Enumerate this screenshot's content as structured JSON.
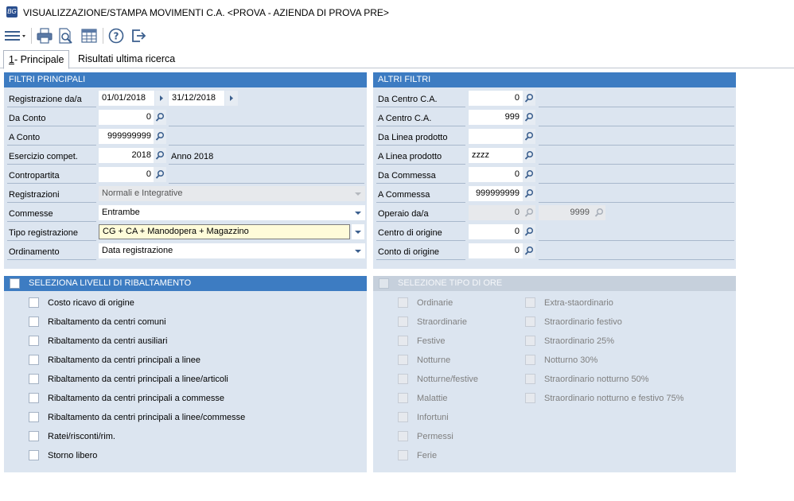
{
  "window": {
    "title": "VISUALIZZAZIONE/STAMPA MOVIMENTI C.A. <PROVA - AZIENDA DI PROVA PRE>",
    "icon": "app-logo-icon"
  },
  "toolbar": {
    "icons": [
      "menu-icon",
      "print-icon",
      "print-preview-icon",
      "grid-icon",
      "help-icon",
      "exit-icon"
    ]
  },
  "tabs": [
    {
      "underline": "1",
      "label": "- Principale"
    },
    {
      "label": "Risultati ultima ricerca"
    }
  ],
  "filtri_principali": {
    "title": "FILTRI PRINCIPALI",
    "registrazione": {
      "label": "Registrazione da/a",
      "from": "01/01/2018",
      "to": "31/12/2018"
    },
    "da_conto": {
      "label": "Da Conto",
      "value": "0"
    },
    "a_conto": {
      "label": "A Conto",
      "value": "999999999"
    },
    "esercizio": {
      "label": "Esercizio compet.",
      "value": "2018",
      "desc": "Anno 2018"
    },
    "contropartita": {
      "label": "Contropartita",
      "value": "0"
    },
    "registrazioni": {
      "label": "Registrazioni",
      "value": "Normali e Integrative"
    },
    "commesse": {
      "label": "Commesse",
      "value": "Entrambe"
    },
    "tipo_registrazione": {
      "label": "Tipo registrazione",
      "value": "CG + CA + Manodopera + Magazzino"
    },
    "ordinamento": {
      "label": "Ordinamento",
      "value": "Data registrazione"
    }
  },
  "altri_filtri": {
    "title": "ALTRI FILTRI",
    "da_centro": {
      "label": "Da Centro C.A.",
      "value": "0"
    },
    "a_centro": {
      "label": "A Centro C.A.",
      "value": "999"
    },
    "da_linea": {
      "label": "Da Linea prodotto",
      "value": ""
    },
    "a_linea": {
      "label": "A Linea prodotto",
      "value": "zzzz"
    },
    "da_commessa": {
      "label": "Da Commessa",
      "value": "0"
    },
    "a_commessa": {
      "label": "A Commessa",
      "value": "999999999"
    },
    "operaio": {
      "label": "Operaio da/a",
      "from": "0",
      "to": "9999"
    },
    "centro_origine": {
      "label": "Centro di origine",
      "value": "0"
    },
    "conto_origine": {
      "label": "Conto di origine",
      "value": "0"
    }
  },
  "livelli": {
    "title": "SELEZIONA LIVELLI DI RIBALTAMENTO",
    "items": [
      "Costo ricavo di origine",
      "Ribaltamento da centri comuni",
      "Ribaltamento da centri ausiliari",
      "Ribaltamento da centri principali a linee",
      "Ribaltamento da centri principali a linee/articoli",
      "Ribaltamento da centri principali a commesse",
      "Ribaltamento da centri principali a linee/commesse",
      "Ratei/risconti/rim.",
      "Storno libero"
    ]
  },
  "tipo_ore": {
    "title": "SELEZIONE TIPO DI ORE",
    "col1": [
      "Ordinarie",
      "Straordinarie",
      "Festive",
      "Notturne",
      "Notturne/festive",
      "Malattie",
      "Infortuni",
      "Permessi",
      "Ferie"
    ],
    "col2": [
      "Extra-staordinario",
      "Straordinario festivo",
      "Straordinario 25%",
      "Notturno 30%",
      "Straordinario notturno 50%",
      "Straordinario notturno e festivo 75%"
    ]
  },
  "colors": {
    "header_blue": "#3d7cc2",
    "panel_bg": "#dce5f0",
    "highlight": "#fefbd9"
  }
}
